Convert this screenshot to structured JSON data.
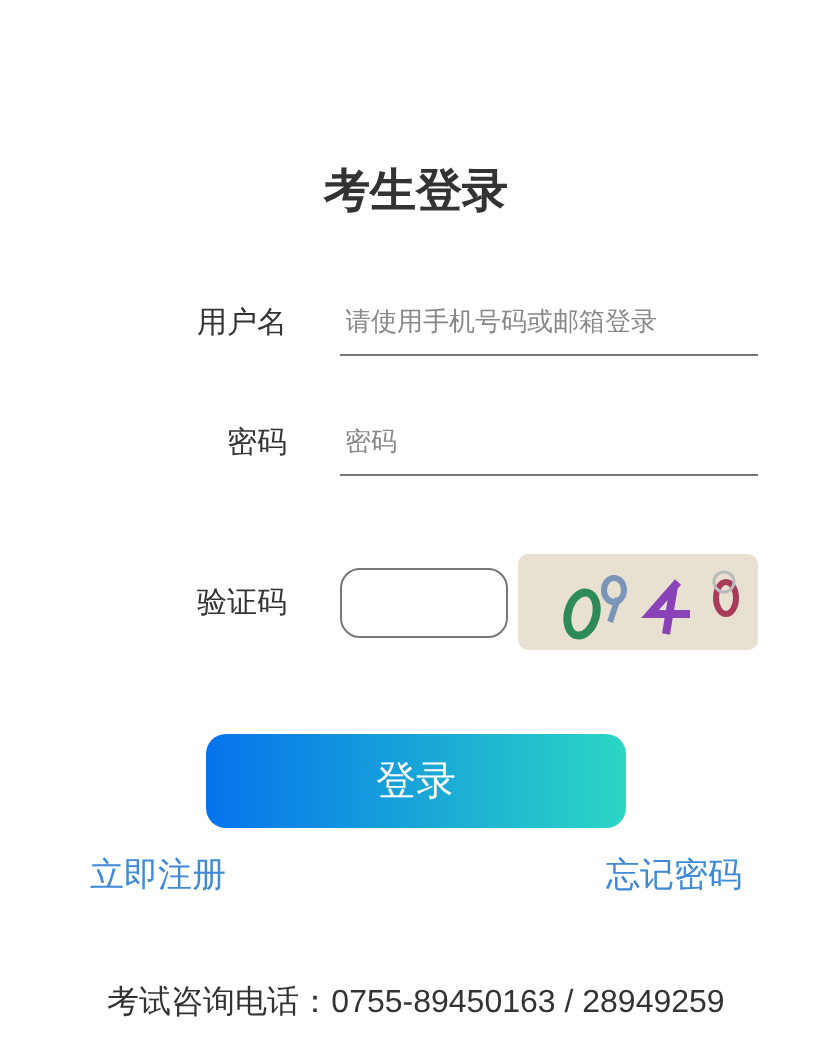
{
  "title": "考生登录",
  "fields": [
    {
      "label": "用户名",
      "placeholder": "请使用手机号码或邮箱登录",
      "kind": "underline"
    },
    {
      "label": "密码",
      "placeholder": "密码",
      "kind": "underline"
    }
  ],
  "captcha": {
    "label": "验证码"
  },
  "login_button": "登录",
  "links": {
    "register": "立即注册",
    "forgot": "忘记密码"
  },
  "footer": "考试咨询电话：0755-89450163 / 28949259"
}
